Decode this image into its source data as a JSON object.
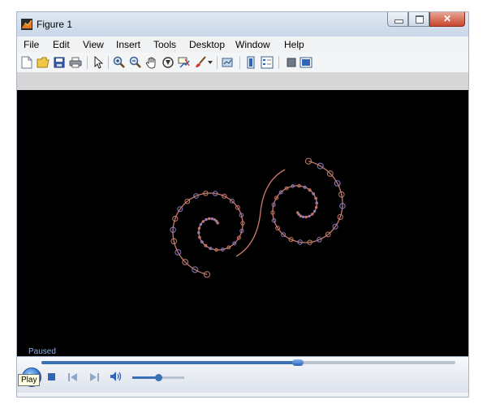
{
  "window": {
    "title": "Figure 1"
  },
  "menu": [
    "File",
    "Edit",
    "View",
    "Insert",
    "Tools",
    "Desktop",
    "Window",
    "Help"
  ],
  "toolbar": {
    "icons": [
      "new-file-icon",
      "open-folder-icon",
      "save-icon",
      "print-icon",
      "pointer-icon",
      "zoom-in-icon",
      "zoom-out-icon",
      "pan-hand-icon",
      "rotate-3d-icon",
      "data-cursor-icon",
      "brush-icon",
      "dropdown-arrow-icon",
      "link-plot-icon",
      "colorbar-icon",
      "legend-icon",
      "hide-plot-tools-icon",
      "show-plot-tools-icon"
    ]
  },
  "player": {
    "status": "Paused",
    "seek_fraction": 0.62,
    "volume_fraction": 0.5,
    "tooltip": "Play"
  },
  "colors": {
    "fractal_stroke": "#c87a6a",
    "fractal_dots": "#8a7fc6",
    "accent": "#3b6fb6"
  }
}
